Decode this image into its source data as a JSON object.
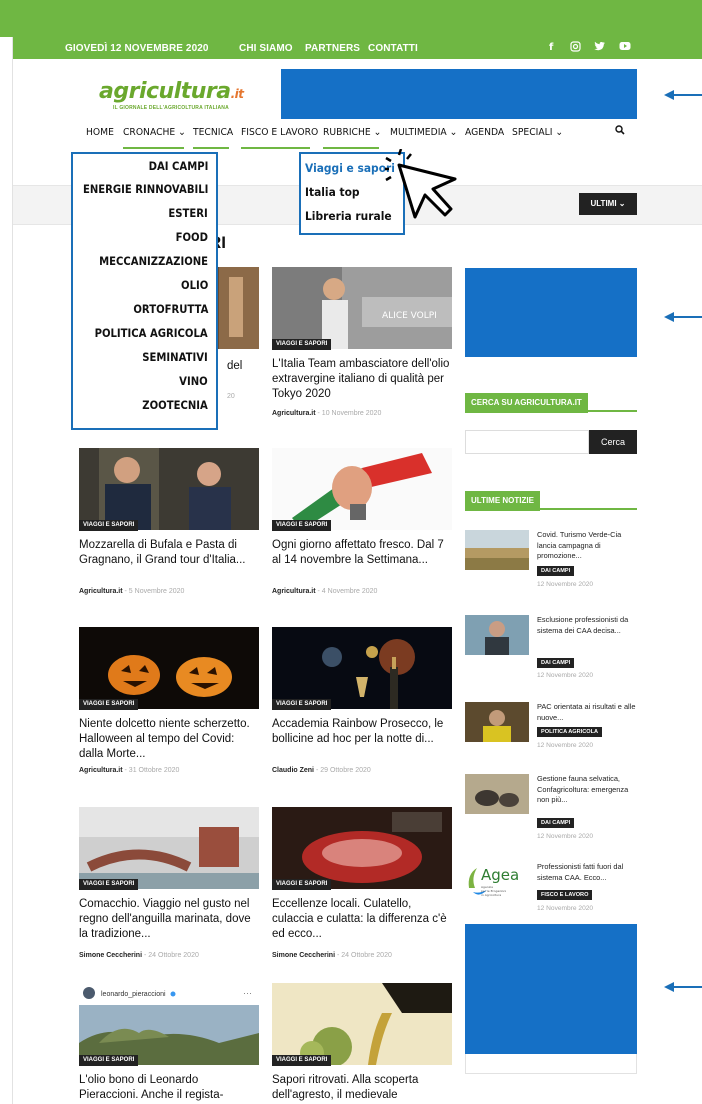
{
  "topbar": {
    "date": "GIOVEDÌ 12 NOVEMBRE 2020",
    "links": [
      "CHI SIAMO",
      "PARTNERS",
      "CONTATTI"
    ],
    "social_icons": [
      "facebook-icon",
      "instagram-icon",
      "twitter-icon",
      "youtube-icon"
    ]
  },
  "logo": {
    "name": "agricultura",
    "suffix": ".it",
    "tagline": "IL GIORNALE DELL'AGRICOLTURA ITALIANA"
  },
  "nav": {
    "items": [
      "HOME",
      "CRONACHE",
      "TECNICA",
      "FISCO E LAVORO",
      "RUBRICHE",
      "MULTIMEDIA",
      "AGENDA",
      "SPECIALI"
    ],
    "search_icon": "search-icon"
  },
  "cronache_menu": [
    "DAI CAMPI",
    "ENERGIE RINNOVABILI",
    "ESTERI",
    "FOOD",
    "MECCANIZZAZIONE",
    "OLIO",
    "ORTOFRUTTA",
    "POLITICA AGRICOLA",
    "SEMINATIVI",
    "VINO",
    "ZOOTECNIA"
  ],
  "rubriche_menu": [
    "Viaggi e sapori",
    "Italia top",
    "Libreria rurale"
  ],
  "ultimi_label": "ULTIMI",
  "section_title": "RI",
  "articles": [
    {
      "badge": "",
      "title": "del",
      "author": "",
      "date": "20"
    },
    {
      "badge": "VIAGGI E SAPORI",
      "title": "L'Italia Team ambasciatore dell'olio extravergine italiano di qualità per Tokyo 2020",
      "author": "Agricultura.it",
      "date": "10 Novembre 2020"
    },
    {
      "badge": "VIAGGI E SAPORI",
      "title": "Mozzarella di Bufala e Pasta di Gragnano, il Grand tour d'Italia...",
      "author": "Agricultura.it",
      "date": "5 Novembre 2020"
    },
    {
      "badge": "VIAGGI E SAPORI",
      "title": "Ogni giorno affettato fresco. Dal 7 al 14 novembre la Settimana...",
      "author": "Agricultura.it",
      "date": "4 Novembre 2020"
    },
    {
      "badge": "VIAGGI E SAPORI",
      "title": "Niente dolcetto niente scherzetto. Halloween al tempo del Covid: dalla Morte...",
      "author": "Agricultura.it",
      "date": "31 Ottobre 2020"
    },
    {
      "badge": "VIAGGI E SAPORI",
      "title": "Accademia Rainbow Prosecco, le bollicine ad hoc per la notte di...",
      "author": "Claudio Zeni",
      "date": "29 Ottobre 2020"
    },
    {
      "badge": "VIAGGI E SAPORI",
      "title": "Comacchio. Viaggio nel gusto nel regno dell'anguilla marinata, dove la tradizione...",
      "author": "Simone Ceccherini",
      "date": "24 Ottobre 2020"
    },
    {
      "badge": "VIAGGI E SAPORI",
      "title": "Eccellenze locali. Culatello, culaccia e culatta: la differenza c'è ed ecco...",
      "author": "Simone Ceccherini",
      "date": "24 Ottobre 2020"
    },
    {
      "badge": "VIAGGI E SAPORI",
      "title": "L'olio bono di Leonardo Pieraccioni. Anche il regista-",
      "author": "",
      "date": "",
      "insta_user": "leonardo_pieraccioni"
    },
    {
      "badge": "VIAGGI E SAPORI",
      "title": "Sapori ritrovati. Alla scoperta dell'agresto, il medievale",
      "author": "",
      "date": ""
    }
  ],
  "sidebar": {
    "search_heading": "CERCA SU AGRICULTURA.IT",
    "search_button": "Cerca",
    "search_placeholder": "",
    "news_heading": "ULTIME NOTIZIE",
    "news": [
      {
        "title": "Covid. Turismo Verde-Cia lancia campagna di promozione...",
        "badge": "DAI CAMPI",
        "date": "12 Novembre 2020"
      },
      {
        "title": "Esclusione professionisti da sistema dei CAA decisa...",
        "badge": "DAI CAMPI",
        "date": "12 Novembre 2020"
      },
      {
        "title": "PAC orientata ai risultati e alle nuove...",
        "badge": "POLITICA AGRICOLA",
        "date": "12 Novembre 2020"
      },
      {
        "title": "Gestione fauna selvatica, Confagricoltura: emergenza non più...",
        "badge": "DAI CAMPI",
        "date": "12 Novembre 2020"
      },
      {
        "title": "Professionisti fatti fuori dal sistema CAA. Ecco...",
        "badge": "FISCO E LAVORO",
        "date": "12 Novembre 2020"
      }
    ],
    "agea_logo_text": "Agea",
    "agea_logo_small": "Agenzia per le Erogazioni in Agricoltura"
  },
  "colors": {
    "green": "#6fb743",
    "blue": "#1570c6",
    "dark": "#222222",
    "menu_border": "#1a6fb8"
  }
}
